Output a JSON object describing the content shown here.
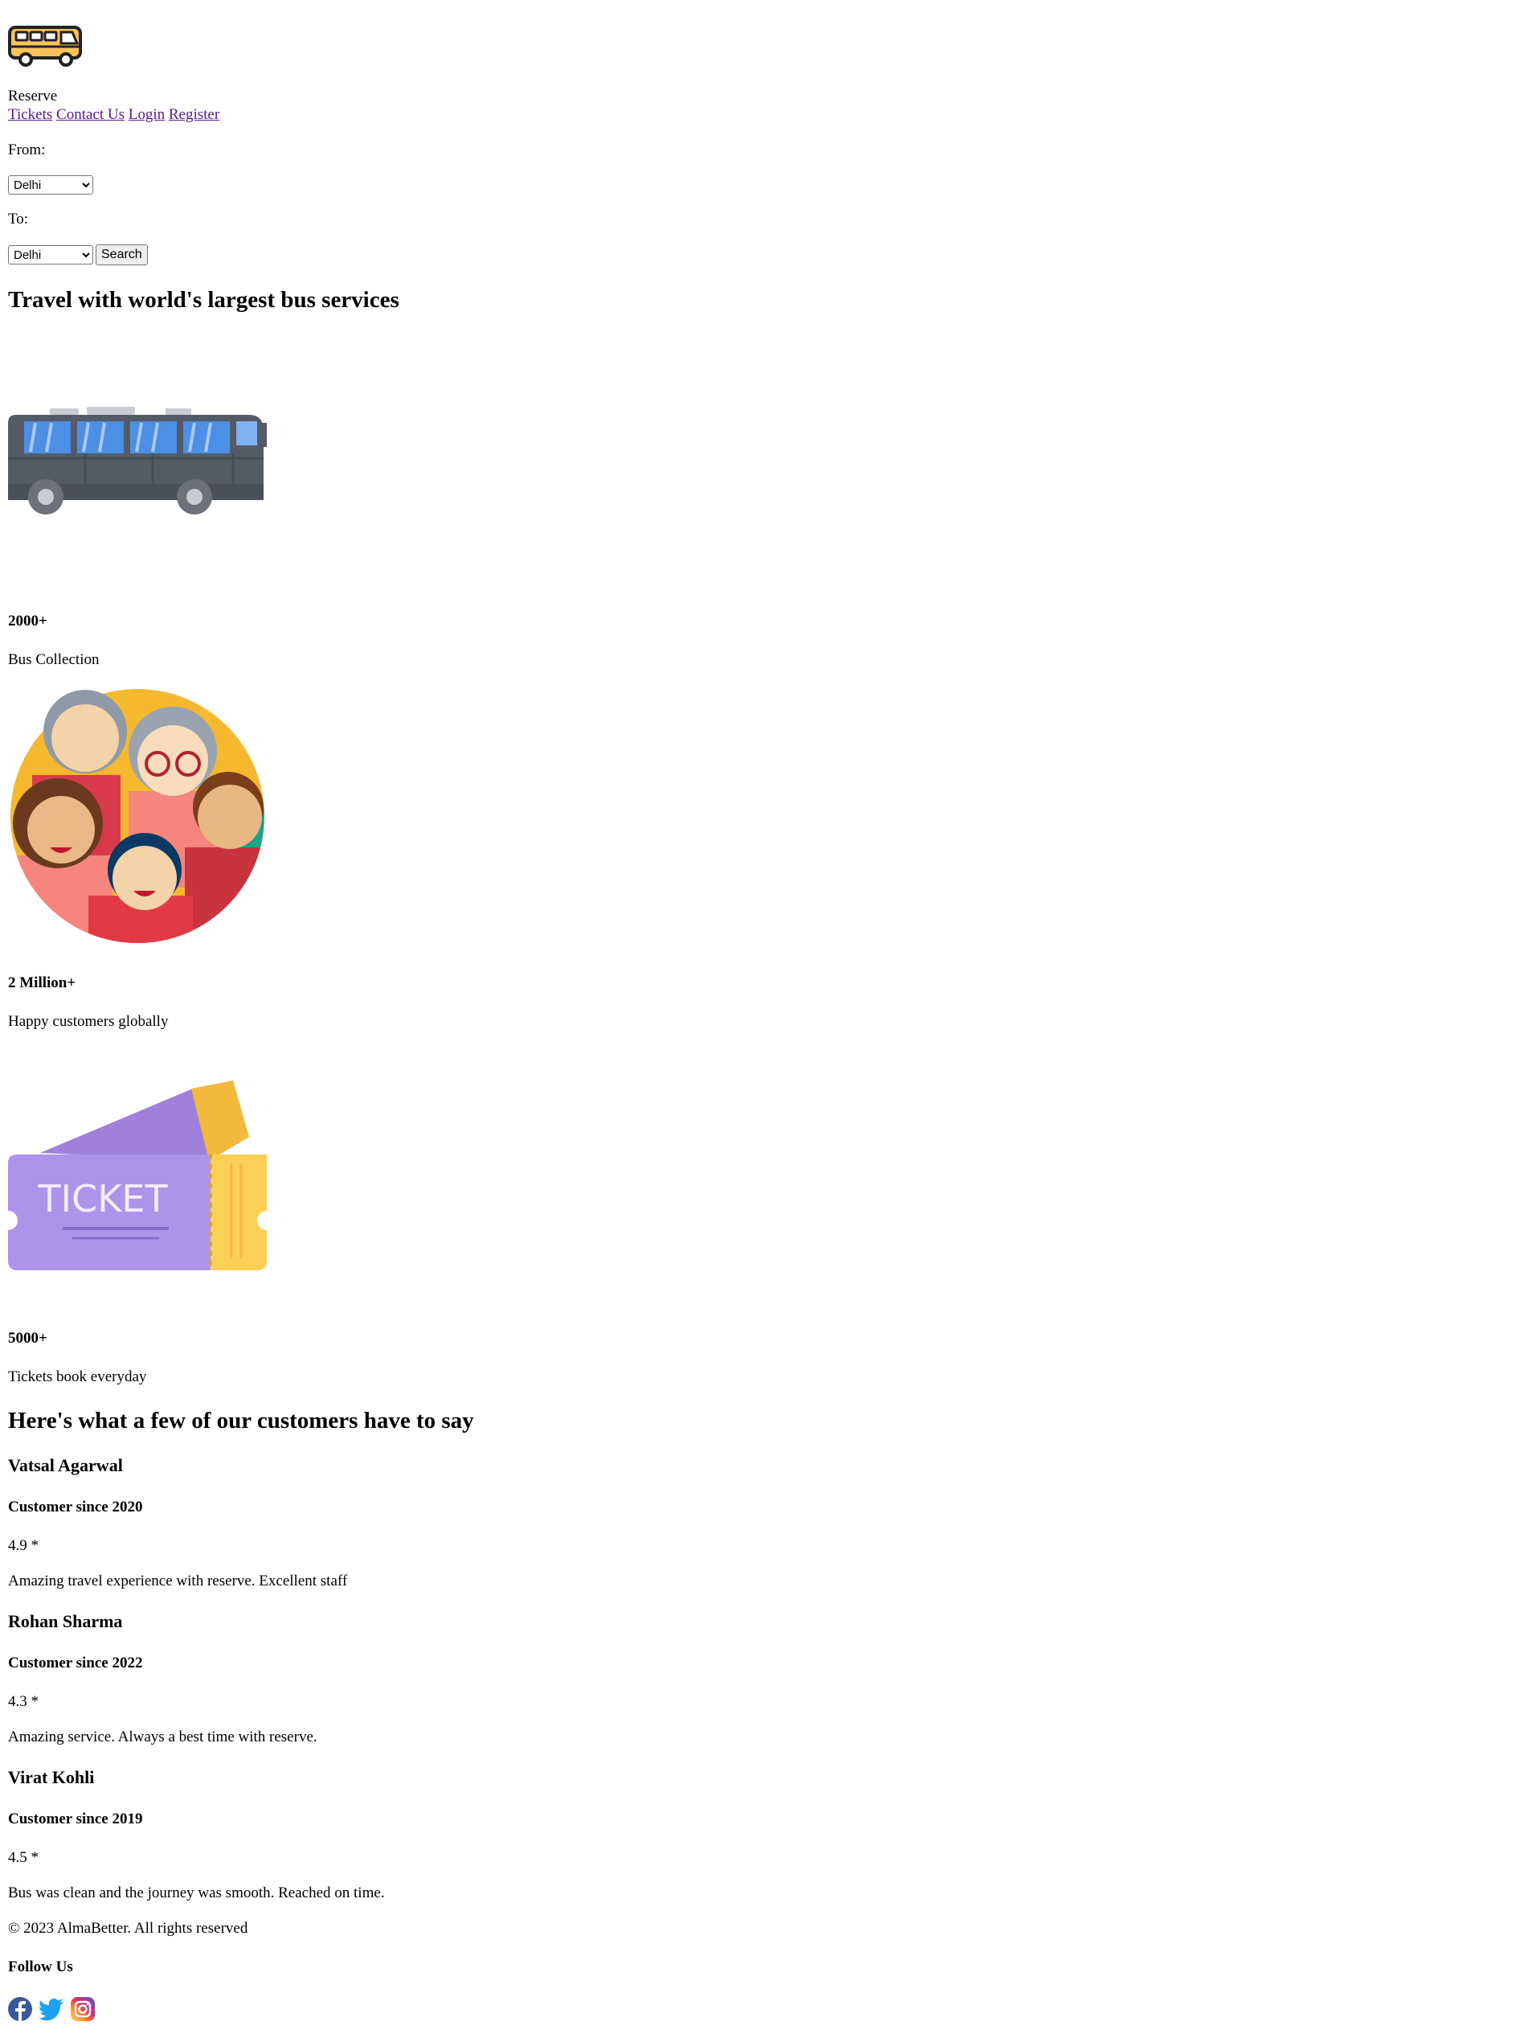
{
  "header": {
    "logo_icon": "bus-logo-icon",
    "brand": "Reserve",
    "nav": [
      {
        "label": "Tickets"
      },
      {
        "label": "Contact Us"
      },
      {
        "label": "Login"
      },
      {
        "label": "Register"
      }
    ]
  },
  "search": {
    "from_label": "From:",
    "from_value": "Delhi",
    "to_label": "To:",
    "to_value": "Delhi",
    "button": "Search"
  },
  "hero_title": "Travel with world's largest bus services",
  "stats": [
    {
      "icon": "bus-illustration",
      "value": "2000+",
      "caption": "Bus Collection"
    },
    {
      "icon": "customers-illustration",
      "value": "2 Million+",
      "caption": "Happy customers globally"
    },
    {
      "icon": "ticket-illustration",
      "value": "5000+",
      "caption": "Tickets book everyday"
    }
  ],
  "ticket_text": "TICKET",
  "testimonials_title": "Here's what a few of our customers have to say",
  "testimonials": [
    {
      "name": "Vatsal Agarwal",
      "since": "Customer since 2020",
      "rating": "4.9 *",
      "text": "Amazing travel experience with reserve. Excellent staff"
    },
    {
      "name": "Rohan Sharma",
      "since": "Customer since 2022",
      "rating": "4.3 *",
      "text": "Amazing service. Always a best time with reserve."
    },
    {
      "name": "Virat Kohli",
      "since": "Customer since 2019",
      "rating": "4.5 *",
      "text": "Bus was clean and the journey was smooth. Reached on time."
    }
  ],
  "footer": {
    "copyright": "© 2023 AlmaBetter. All rights reserved",
    "follow": "Follow Us",
    "social": [
      "facebook-icon",
      "twitter-icon",
      "instagram-icon"
    ]
  },
  "colors": {
    "link": "#551a8b",
    "logo_bus": "#f9c35a",
    "bus_body": "#555b66",
    "bus_window": "#4c8fe6",
    "ticket_purple": "#ae93ea",
    "ticket_yellow": "#fcd056"
  }
}
